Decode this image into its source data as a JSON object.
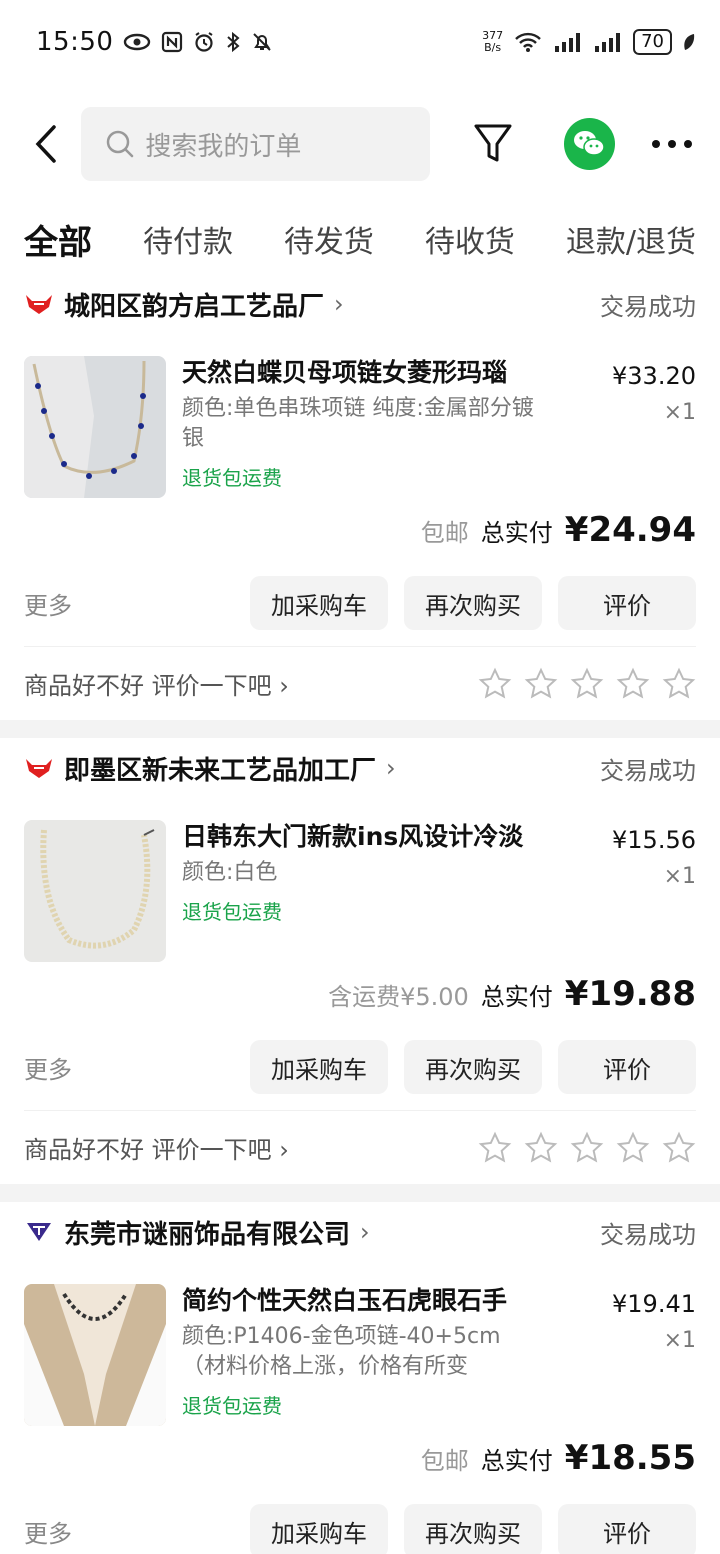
{
  "status": {
    "time": "15:50",
    "speed": "377\nB/s",
    "signal_label": "6",
    "battery": "70"
  },
  "header": {
    "search_placeholder": "搜索我的订单"
  },
  "tabs": [
    "全部",
    "待付款",
    "待发货",
    "待收货",
    "退款/退货"
  ],
  "orders": [
    {
      "shop": "城阳区韵方启工艺品厂",
      "chevron": "›",
      "state": "交易成功",
      "title": "天然白蝶贝母项链女菱形玛瑙",
      "spec": "颜色:单色串珠项链 纯度:金属部分镀银",
      "refund": "退货包运费",
      "price": "¥33.20",
      "qty": "×1",
      "note": "包邮",
      "total_label": "总实付",
      "total": "¥24.94",
      "more": "更多",
      "btn_cart": "加采购车",
      "btn_rebuy": "再次购买",
      "btn_review": "评价",
      "ask": "商品好不好 评价一下吧 ›",
      "logo_color": "#e02020"
    },
    {
      "shop": "即墨区新未来工艺品加工厂",
      "chevron": "›",
      "state": "交易成功",
      "title": "日韩东大门新款ins风设计冷淡",
      "spec": "颜色:白色",
      "refund": "退货包运费",
      "price": "¥15.56",
      "qty": "×1",
      "note": "含运费¥5.00",
      "total_label": "总实付",
      "total": "¥19.88",
      "more": "更多",
      "btn_cart": "加采购车",
      "btn_rebuy": "再次购买",
      "btn_review": "评价",
      "ask": "商品好不好 评价一下吧 ›",
      "logo_color": "#e02020"
    },
    {
      "shop": "东莞市谜丽饰品有限公司",
      "chevron": "›",
      "state": "交易成功",
      "title": "简约个性天然白玉石虎眼石手",
      "spec": "颜色:P1406-金色项链-40+5cm（材料价格上涨，价格有所变",
      "refund": "退货包运费",
      "price": "¥19.41",
      "qty": "×1",
      "note": "包邮",
      "total_label": "总实付",
      "total": "¥18.55",
      "more": "更多",
      "btn_cart": "加采购车",
      "btn_rebuy": "再次购买",
      "btn_review": "评价",
      "logo_color": "#3a2a8c"
    }
  ],
  "colors": {
    "accent_green": "#1aa34a",
    "wechat": "#1ab54a"
  }
}
